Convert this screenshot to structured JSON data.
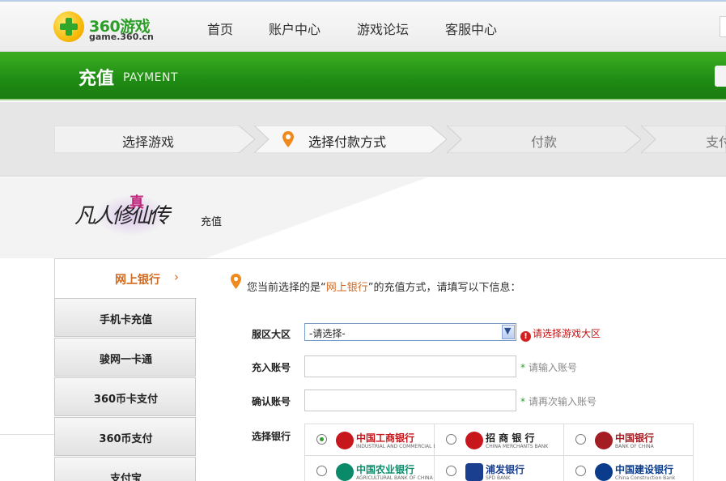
{
  "header": {
    "logo_name": "360游戏",
    "logo_domain": "game.360.cn",
    "nav": [
      "首页",
      "账户中心",
      "游戏论坛",
      "客服中心"
    ]
  },
  "banner": {
    "title": "充值",
    "subtitle": "PAYMENT"
  },
  "steps": [
    {
      "label": "选择游戏",
      "active": false
    },
    {
      "label": "选择付款方式",
      "active": true
    },
    {
      "label": "付款",
      "active": false
    },
    {
      "label": "支付",
      "active": false
    }
  ],
  "game": {
    "logo_text": "凡人修仙传",
    "logo_mark": "真",
    "recharge_label": "充值"
  },
  "sidebar": {
    "active": {
      "label": "网上银行",
      "arrow": "›"
    },
    "items": [
      "手机卡充值",
      "骏网一卡通",
      "360币卡支付",
      "360币支付",
      "支付宝"
    ]
  },
  "notice": {
    "prefix": "您当前选择的是“",
    "highlight": "网上银行",
    "suffix": "”的充值方式，请填写以下信息："
  },
  "form": {
    "server_label": "服区大区",
    "server_value": "-请选择-",
    "server_error": "请选择游戏大区",
    "account_label": "充入账号",
    "account_hint": "请输入账号",
    "confirm_label": "确认账号",
    "confirm_hint": "请再次输入账号",
    "bank_label": "选择银行",
    "star": "*"
  },
  "banks": [
    {
      "name": "中国工商银行",
      "sub": "INDUSTRIAL AND COMMERCIAL BANK OF CHINA",
      "color": "#c8161d",
      "selected": true
    },
    {
      "name": "招 商 银 行",
      "sub": "CHINA MERCHANTS BANK",
      "color": "#c8161d",
      "selected": false
    },
    {
      "name": "中国银行",
      "sub": "BANK OF CHINA",
      "color": "#a31d22",
      "selected": false
    },
    {
      "name": "中国农业银行",
      "sub": "AGRICULTURAL BANK OF CHINA",
      "color": "#0b8a6a",
      "selected": false
    },
    {
      "name": "浦发银行",
      "sub": "SPD BANK",
      "color": "#1b3f8f",
      "selected": false
    },
    {
      "name": "中国建设银行",
      "sub": "China Construction Bank",
      "color": "#0b3c8c",
      "selected": false
    }
  ],
  "colors": {
    "brand_green": "#2e9e2a",
    "accent_orange": "#d2691e",
    "error_red": "#c81010"
  }
}
